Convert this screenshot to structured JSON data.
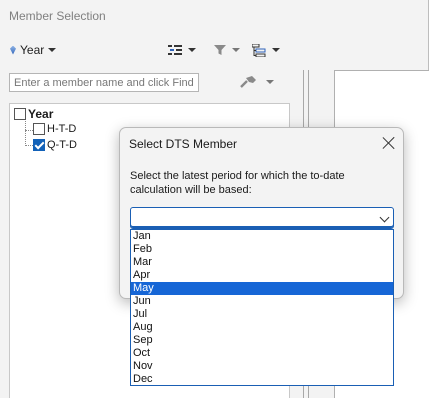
{
  "window": {
    "title": "Member Selection"
  },
  "toolbar": {
    "dimension_label": "Year"
  },
  "search": {
    "placeholder": "Enter a member name and click Find."
  },
  "tree": {
    "root": "Year",
    "items": [
      {
        "label": "H-T-D",
        "checked": false
      },
      {
        "label": "Q-T-D",
        "checked": true
      }
    ]
  },
  "dialog": {
    "title": "Select DTS Member",
    "prompt": "Select the latest period for which the to-date calculation will be based:",
    "combo_value": "",
    "options": [
      "Jan",
      "Feb",
      "Mar",
      "Apr",
      "May",
      "Jun",
      "Jul",
      "Aug",
      "Sep",
      "Oct",
      "Nov",
      "Dec"
    ],
    "highlighted_option": "May"
  },
  "colors": {
    "accent": "#1a5fb4",
    "highlight": "#1666d6",
    "check": "#1261b8"
  }
}
